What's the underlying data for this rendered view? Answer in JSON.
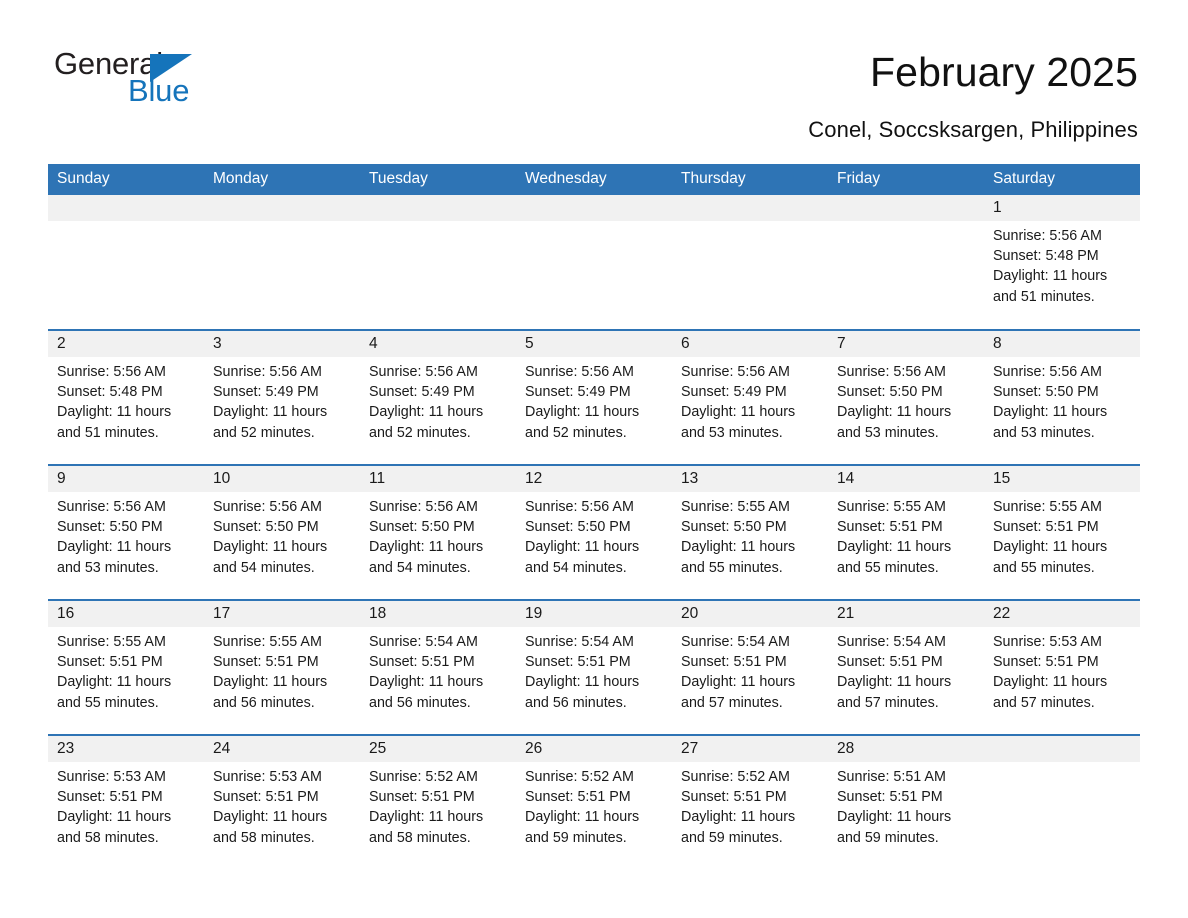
{
  "brand": {
    "name_part1": "General",
    "name_part2": "Blue",
    "triangle_color": "#1574bb"
  },
  "header": {
    "month_title": "February 2025",
    "location": "Conel, Soccsksargen, Philippines",
    "header_bg": "#2e74b5",
    "date_band_bg": "#f1f1f1"
  },
  "weekdays": [
    "Sunday",
    "Monday",
    "Tuesday",
    "Wednesday",
    "Thursday",
    "Friday",
    "Saturday"
  ],
  "weeks": [
    [
      {
        "day": "",
        "info": ""
      },
      {
        "day": "",
        "info": ""
      },
      {
        "day": "",
        "info": ""
      },
      {
        "day": "",
        "info": ""
      },
      {
        "day": "",
        "info": ""
      },
      {
        "day": "",
        "info": ""
      },
      {
        "day": "1",
        "info": "Sunrise: 5:56 AM\nSunset: 5:48 PM\nDaylight: 11 hours\nand 51 minutes."
      }
    ],
    [
      {
        "day": "2",
        "info": "Sunrise: 5:56 AM\nSunset: 5:48 PM\nDaylight: 11 hours\nand 51 minutes."
      },
      {
        "day": "3",
        "info": "Sunrise: 5:56 AM\nSunset: 5:49 PM\nDaylight: 11 hours\nand 52 minutes."
      },
      {
        "day": "4",
        "info": "Sunrise: 5:56 AM\nSunset: 5:49 PM\nDaylight: 11 hours\nand 52 minutes."
      },
      {
        "day": "5",
        "info": "Sunrise: 5:56 AM\nSunset: 5:49 PM\nDaylight: 11 hours\nand 52 minutes."
      },
      {
        "day": "6",
        "info": "Sunrise: 5:56 AM\nSunset: 5:49 PM\nDaylight: 11 hours\nand 53 minutes."
      },
      {
        "day": "7",
        "info": "Sunrise: 5:56 AM\nSunset: 5:50 PM\nDaylight: 11 hours\nand 53 minutes."
      },
      {
        "day": "8",
        "info": "Sunrise: 5:56 AM\nSunset: 5:50 PM\nDaylight: 11 hours\nand 53 minutes."
      }
    ],
    [
      {
        "day": "9",
        "info": "Sunrise: 5:56 AM\nSunset: 5:50 PM\nDaylight: 11 hours\nand 53 minutes."
      },
      {
        "day": "10",
        "info": "Sunrise: 5:56 AM\nSunset: 5:50 PM\nDaylight: 11 hours\nand 54 minutes."
      },
      {
        "day": "11",
        "info": "Sunrise: 5:56 AM\nSunset: 5:50 PM\nDaylight: 11 hours\nand 54 minutes."
      },
      {
        "day": "12",
        "info": "Sunrise: 5:56 AM\nSunset: 5:50 PM\nDaylight: 11 hours\nand 54 minutes."
      },
      {
        "day": "13",
        "info": "Sunrise: 5:55 AM\nSunset: 5:50 PM\nDaylight: 11 hours\nand 55 minutes."
      },
      {
        "day": "14",
        "info": "Sunrise: 5:55 AM\nSunset: 5:51 PM\nDaylight: 11 hours\nand 55 minutes."
      },
      {
        "day": "15",
        "info": "Sunrise: 5:55 AM\nSunset: 5:51 PM\nDaylight: 11 hours\nand 55 minutes."
      }
    ],
    [
      {
        "day": "16",
        "info": "Sunrise: 5:55 AM\nSunset: 5:51 PM\nDaylight: 11 hours\nand 55 minutes."
      },
      {
        "day": "17",
        "info": "Sunrise: 5:55 AM\nSunset: 5:51 PM\nDaylight: 11 hours\nand 56 minutes."
      },
      {
        "day": "18",
        "info": "Sunrise: 5:54 AM\nSunset: 5:51 PM\nDaylight: 11 hours\nand 56 minutes."
      },
      {
        "day": "19",
        "info": "Sunrise: 5:54 AM\nSunset: 5:51 PM\nDaylight: 11 hours\nand 56 minutes."
      },
      {
        "day": "20",
        "info": "Sunrise: 5:54 AM\nSunset: 5:51 PM\nDaylight: 11 hours\nand 57 minutes."
      },
      {
        "day": "21",
        "info": "Sunrise: 5:54 AM\nSunset: 5:51 PM\nDaylight: 11 hours\nand 57 minutes."
      },
      {
        "day": "22",
        "info": "Sunrise: 5:53 AM\nSunset: 5:51 PM\nDaylight: 11 hours\nand 57 minutes."
      }
    ],
    [
      {
        "day": "23",
        "info": "Sunrise: 5:53 AM\nSunset: 5:51 PM\nDaylight: 11 hours\nand 58 minutes."
      },
      {
        "day": "24",
        "info": "Sunrise: 5:53 AM\nSunset: 5:51 PM\nDaylight: 11 hours\nand 58 minutes."
      },
      {
        "day": "25",
        "info": "Sunrise: 5:52 AM\nSunset: 5:51 PM\nDaylight: 11 hours\nand 58 minutes."
      },
      {
        "day": "26",
        "info": "Sunrise: 5:52 AM\nSunset: 5:51 PM\nDaylight: 11 hours\nand 59 minutes."
      },
      {
        "day": "27",
        "info": "Sunrise: 5:52 AM\nSunset: 5:51 PM\nDaylight: 11 hours\nand 59 minutes."
      },
      {
        "day": "28",
        "info": "Sunrise: 5:51 AM\nSunset: 5:51 PM\nDaylight: 11 hours\nand 59 minutes."
      },
      {
        "day": "",
        "info": ""
      }
    ]
  ]
}
